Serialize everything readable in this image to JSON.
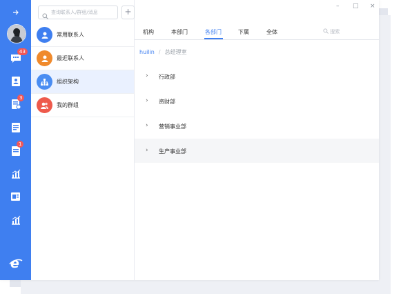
{
  "rail": {
    "badges": {
      "messages": "43",
      "approvals": "3",
      "reports": "1"
    }
  },
  "contacts": {
    "search_placeholder": "查询联系人/群组/消息",
    "add_label": "+",
    "items": [
      {
        "label": "常用联系人",
        "color": "#3f7ff0"
      },
      {
        "label": "最近联系人",
        "color": "#f08a2c"
      },
      {
        "label": "组织架构",
        "color": "#4a8df2"
      },
      {
        "label": "我的群组",
        "color": "#ee5a4c"
      }
    ]
  },
  "window_controls": {
    "minimize": "–",
    "maximize": "□",
    "close": "×"
  },
  "tabs": [
    {
      "label": "机构"
    },
    {
      "label": "本部门"
    },
    {
      "label": "各部门"
    },
    {
      "label": "下属"
    },
    {
      "label": "全体"
    }
  ],
  "main_search_placeholder": "搜索",
  "breadcrumb": {
    "root": "huilin",
    "sep": "/",
    "current": "总经理室"
  },
  "departments": [
    {
      "chev": "›",
      "name": "行政部"
    },
    {
      "chev": "›",
      "name": "资财部"
    },
    {
      "chev": "›",
      "name": "营销事业部"
    },
    {
      "chev": "›",
      "name": "生产事业部"
    }
  ]
}
